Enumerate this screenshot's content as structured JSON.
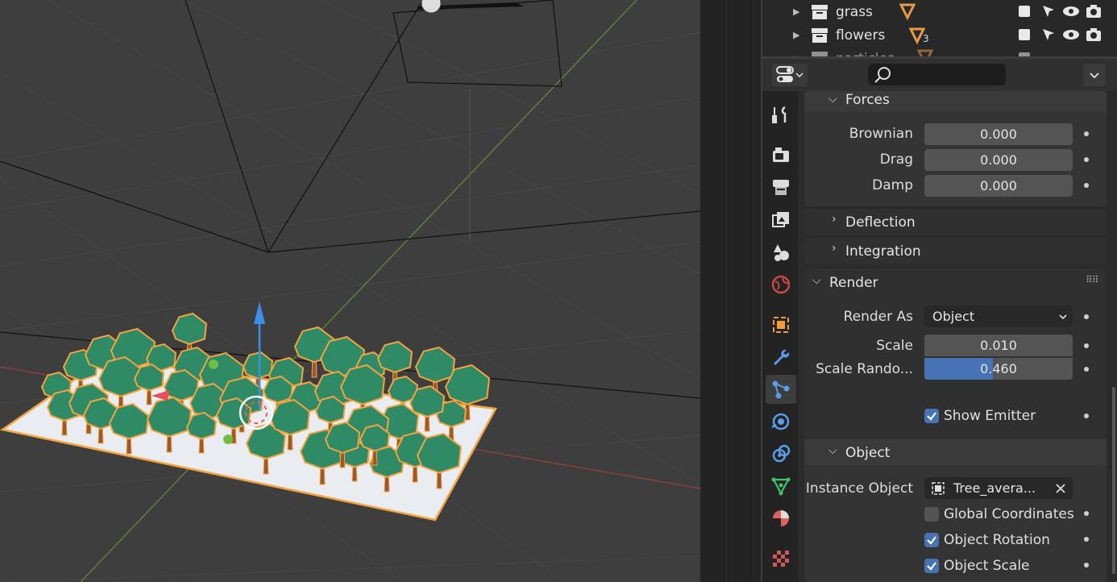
{
  "outliner": {
    "items": [
      {
        "label": "grass",
        "sub": ""
      },
      {
        "label": "flowers",
        "sub": "3"
      },
      {
        "label": "particles",
        "sub": ""
      }
    ]
  },
  "properties": {
    "forces": {
      "title": "Forces",
      "brownian_label": "Brownian",
      "brownian_value": "0.000",
      "drag_label": "Drag",
      "drag_value": "0.000",
      "damp_label": "Damp",
      "damp_value": "0.000"
    },
    "deflection": {
      "title": "Deflection"
    },
    "integration": {
      "title": "Integration"
    },
    "render": {
      "title": "Render",
      "render_as_label": "Render As",
      "render_as_value": "Object",
      "scale_label": "Scale",
      "scale_value": "0.010",
      "scale_random_label": "Scale Rando...",
      "scale_random_value": "0.460",
      "scale_random_fraction": 0.46,
      "show_emitter_label": "Show Emitter",
      "show_emitter_checked": true
    },
    "object": {
      "title": "Object",
      "instance_object_label": "Instance Object",
      "instance_object_value": "Tree_avera...",
      "global_coordinates_label": "Global Coordinates",
      "global_coordinates_checked": false,
      "object_rotation_label": "Object Rotation",
      "object_rotation_checked": true,
      "object_scale_label": "Object Scale",
      "object_scale_checked": true
    }
  },
  "tabs": [
    "tool-icon",
    "render-icon",
    "output-icon",
    "view-layer-icon",
    "scene-icon",
    "world-icon",
    "object-icon",
    "modifier-icon",
    "particles-icon",
    "physics-icon",
    "constraints-icon",
    "data-icon",
    "material-icon",
    "texture-icon"
  ],
  "colors": {
    "accent": "#4772b3",
    "selection": "#f4a340",
    "tree": "#2f8a66",
    "ground": "#e9edf2"
  }
}
